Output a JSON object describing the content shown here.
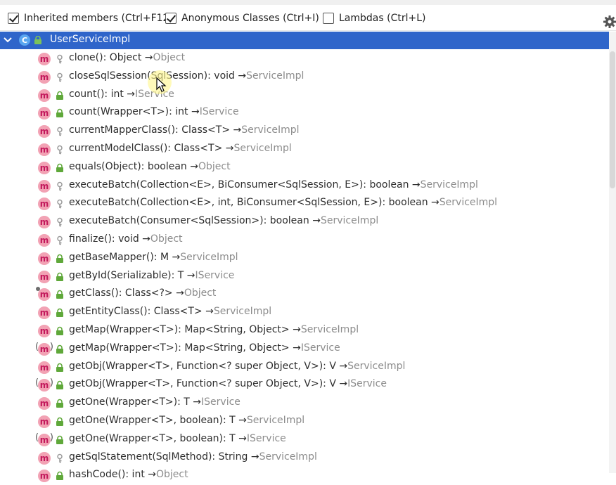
{
  "toolbar": {
    "options": [
      {
        "label": "Inherited members (Ctrl+F12)",
        "checked": true
      },
      {
        "label": "Anonymous Classes (Ctrl+I)",
        "checked": true
      },
      {
        "label": "Lambdas (Ctrl+L)",
        "checked": false
      }
    ],
    "settings_icon": "gear-icon"
  },
  "root": {
    "label": "UserServiceImpl",
    "icon_letter": "C",
    "expanded": true
  },
  "members": [
    {
      "name": "clone(): Object",
      "origin": "Object",
      "visibility": "protected",
      "icon": "method"
    },
    {
      "name": "closeSqlSession(SqlSession): void",
      "origin": "ServiceImpl",
      "visibility": "protected",
      "icon": "method"
    },
    {
      "name": "count(): int",
      "origin": "IService",
      "visibility": "public",
      "icon": "method"
    },
    {
      "name": "count(Wrapper<T>): int",
      "origin": "IService",
      "visibility": "public",
      "icon": "method"
    },
    {
      "name": "currentMapperClass(): Class<T>",
      "origin": "ServiceImpl",
      "visibility": "protected",
      "icon": "method"
    },
    {
      "name": "currentModelClass(): Class<T>",
      "origin": "ServiceImpl",
      "visibility": "protected",
      "icon": "method"
    },
    {
      "name": "equals(Object): boolean",
      "origin": "Object",
      "visibility": "public",
      "icon": "method"
    },
    {
      "name": "executeBatch(Collection<E>, BiConsumer<SqlSession, E>): boolean",
      "origin": "ServiceImpl",
      "visibility": "protected",
      "icon": "method"
    },
    {
      "name": "executeBatch(Collection<E>, int, BiConsumer<SqlSession, E>): boolean",
      "origin": "ServiceImpl",
      "visibility": "protected",
      "icon": "method"
    },
    {
      "name": "executeBatch(Consumer<SqlSession>): boolean",
      "origin": "ServiceImpl",
      "visibility": "protected",
      "icon": "method"
    },
    {
      "name": "finalize(): void",
      "origin": "Object",
      "visibility": "protected",
      "icon": "method"
    },
    {
      "name": "getBaseMapper(): M",
      "origin": "ServiceImpl",
      "visibility": "public",
      "icon": "method"
    },
    {
      "name": "getById(Serializable): T",
      "origin": "IService",
      "visibility": "public",
      "icon": "method"
    },
    {
      "name": "getClass(): Class<?>",
      "origin": "Object",
      "visibility": "public",
      "icon": "method-final"
    },
    {
      "name": "getEntityClass(): Class<T>",
      "origin": "ServiceImpl",
      "visibility": "public",
      "icon": "method"
    },
    {
      "name": "getMap(Wrapper<T>): Map<String, Object>",
      "origin": "ServiceImpl",
      "visibility": "public",
      "icon": "method"
    },
    {
      "name": "getMap(Wrapper<T>): Map<String, Object>",
      "origin": "IService",
      "visibility": "public",
      "icon": "method-abstract"
    },
    {
      "name": "getObj(Wrapper<T>, Function<? super Object, V>): V",
      "origin": "ServiceImpl",
      "visibility": "public",
      "icon": "method"
    },
    {
      "name": "getObj(Wrapper<T>, Function<? super Object, V>): V",
      "origin": "IService",
      "visibility": "public",
      "icon": "method-abstract"
    },
    {
      "name": "getOne(Wrapper<T>): T",
      "origin": "IService",
      "visibility": "public",
      "icon": "method"
    },
    {
      "name": "getOne(Wrapper<T>, boolean): T",
      "origin": "ServiceImpl",
      "visibility": "public",
      "icon": "method"
    },
    {
      "name": "getOne(Wrapper<T>, boolean): T",
      "origin": "IService",
      "visibility": "public",
      "icon": "method-abstract"
    },
    {
      "name": "getSqlStatement(SqlMethod): String",
      "origin": "ServiceImpl",
      "visibility": "protected",
      "icon": "method"
    },
    {
      "name": "hashCode(): int",
      "origin": "Object",
      "visibility": "public",
      "icon": "method"
    }
  ],
  "colors": {
    "selection": "#2f65ca",
    "method_icon": "#f2a2b4",
    "public_lock": "#5fa83a",
    "protected_key": "#9a9a9a",
    "origin_text": "#8c8c8c"
  }
}
